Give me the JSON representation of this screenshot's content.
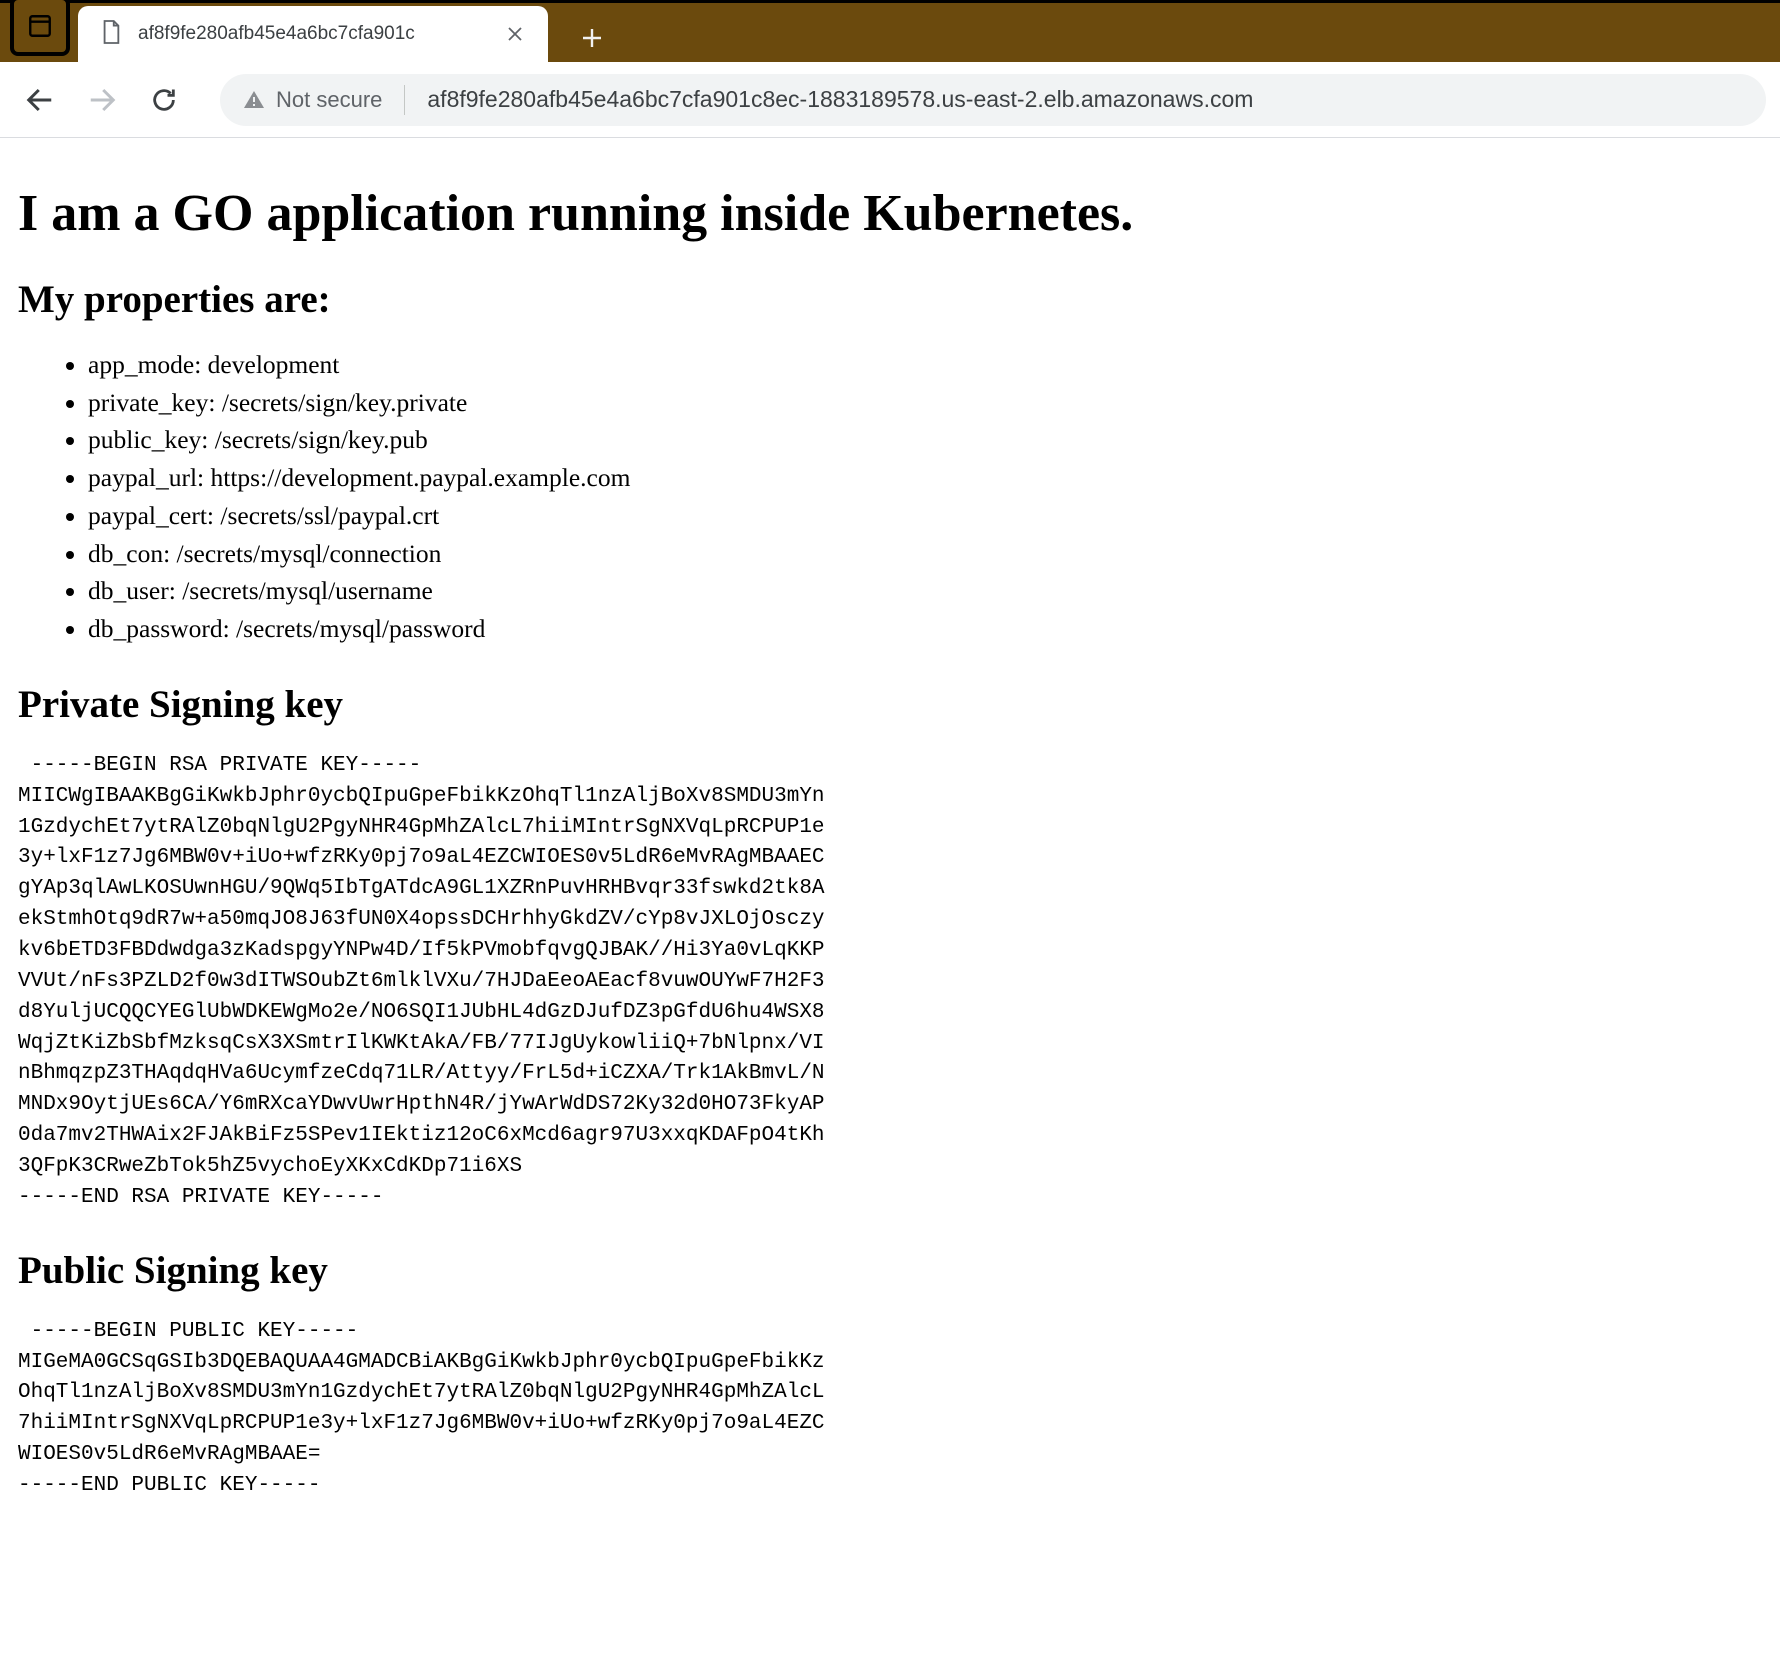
{
  "browser": {
    "tab_title": "af8f9fe280afb45e4a6bc7cfa901c",
    "secure_label": "Not secure",
    "url": "af8f9fe280afb45e4a6bc7cfa901c8ec-1883189578.us-east-2.elb.amazonaws.com"
  },
  "page": {
    "h1": "I am a GO application running inside Kubernetes.",
    "props_heading": "My properties are:",
    "properties": [
      "app_mode: development",
      "private_key: /secrets/sign/key.private",
      "public_key: /secrets/sign/key.pub",
      "paypal_url: https://development.paypal.example.com",
      "paypal_cert: /secrets/ssl/paypal.crt",
      "db_con: /secrets/mysql/connection",
      "db_user: /secrets/mysql/username",
      "db_password: /secrets/mysql/password"
    ],
    "priv_heading": "Private Signing key",
    "priv_key": " -----BEGIN RSA PRIVATE KEY-----\nMIICWgIBAAKBgGiKwkbJphr0ycbQIpuGpeFbikKzOhqTl1nzAljBoXv8SMDU3mYn\n1GzdychEt7ytRAlZ0bqNlgU2PgyNHR4GpMhZAlcL7hiiMIntrSgNXVqLpRCPUP1e\n3y+lxF1z7Jg6MBW0v+iUo+wfzRKy0pj7o9aL4EZCWIOES0v5LdR6eMvRAgMBAAEC\ngYAp3qlAwLKOSUwnHGU/9QWq5IbTgATdcA9GL1XZRnPuvHRHBvqr33fswkd2tk8A\nekStmhOtq9dR7w+a50mqJO8J63fUN0X4opssDCHrhhyGkdZV/cYp8vJXLOjOsczy\nkv6bETD3FBDdwdga3zKadspgyYNPw4D/If5kPVmobfqvgQJBAK//Hi3Ya0vLqKKP\nVVUt/nFs3PZLD2f0w3dITWSOubZt6mlklVXu/7HJDaEeoAEacf8vuwOUYwF7H2F3\nd8YuljUCQQCYEGlUbWDKEWgMo2e/NO6SQI1JUbHL4dGzDJufDZ3pGfdU6hu4WSX8\nWqjZtKiZbSbfMzksqCsX3XSmtrIlKWKtAkA/FB/77IJgUykowliiQ+7bNlpnx/VI\nnBhmqzpZ3THAqdqHVa6UcymfzeCdq71LR/Attyy/FrL5d+iCZXA/Trk1AkBmvL/N\nMNDx9OytjUEs6CA/Y6mRXcaYDwvUwrHpthN4R/jYwArWdDS72Ky32d0HO73FkyAP\n0da7mv2THWAix2FJAkBiFz5SPev1IEktiz12oC6xMcd6agr97U3xxqKDAFpO4tKh\n3QFpK3CRweZbTok5hZ5vychoEyXKxCdKDp71i6XS\n-----END RSA PRIVATE KEY-----",
    "pub_heading": "Public Signing key",
    "pub_key": " -----BEGIN PUBLIC KEY-----\nMIGeMA0GCSqGSIb3DQEBAQUAA4GMADCBiAKBgGiKwkbJphr0ycbQIpuGpeFbikKz\nOhqTl1nzAljBoXv8SMDU3mYn1GzdychEt7ytRAlZ0bqNlgU2PgyNHR4GpMhZAlcL\n7hiiMIntrSgNXVqLpRCPUP1e3y+lxF1z7Jg6MBW0v+iUo+wfzRKy0pj7o9aL4EZC\nWIOES0v5LdR6eMvRAgMBAAE=\n-----END PUBLIC KEY-----"
  }
}
